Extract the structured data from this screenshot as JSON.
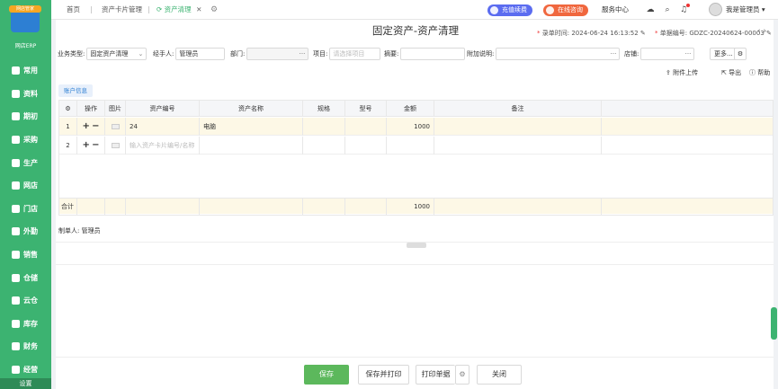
{
  "brand": {
    "badge": "网店管家",
    "logo_text": "网店ERP"
  },
  "nav": [
    {
      "label": "常用"
    },
    {
      "label": "资料"
    },
    {
      "label": "期初"
    },
    {
      "label": "采购"
    },
    {
      "label": "生产"
    },
    {
      "label": "网店"
    },
    {
      "label": "门店"
    },
    {
      "label": "外勤"
    },
    {
      "label": "销售"
    },
    {
      "label": "仓储"
    },
    {
      "label": "云仓"
    },
    {
      "label": "库存"
    },
    {
      "label": "财务"
    },
    {
      "label": "经营"
    }
  ],
  "settings_label": "设置",
  "tabs": {
    "home": "首页",
    "card_mgmt": "资产卡片管理",
    "clearance": "资产清理",
    "close": "✕"
  },
  "top_actions": {
    "recharge": "充值续费",
    "consult": "在线咨询",
    "service": "服务中心",
    "user": "我是管理员"
  },
  "colors": {
    "recharge": "#5b6cf0",
    "consult": "#f0673e",
    "accent": "#3cb371"
  },
  "page": {
    "title": "固定资产-资产清理",
    "entry_time_label": "录单时间:",
    "entry_time": "2024-06-24 16:13:52",
    "doc_no_label": "单据编号:",
    "doc_no": "GDZC-20240624-00003"
  },
  "form": {
    "biz_type_label": "业务类型:",
    "biz_type": "固定资产清理",
    "handler_label": "经手人:",
    "handler": "管理员",
    "dept_label": "部门:",
    "project_label": "项目:",
    "project_ph": "请选择项目",
    "summary_label": "摘要:",
    "note_label": "附加说明:",
    "store_label": "店铺:",
    "more_label": "更多..."
  },
  "actions": {
    "upload": "附件上传",
    "export": "导出",
    "help": "帮助"
  },
  "account_tab": "账户信息",
  "grid": {
    "headers": {
      "op": "操作",
      "img": "图片",
      "code": "资产编号",
      "name": "资产名称",
      "spec": "规格",
      "model": "型号",
      "amount": "金额",
      "remark": "备注"
    },
    "rows": [
      {
        "idx": "1",
        "code": "24",
        "name": "电脑",
        "amount": "1000"
      },
      {
        "idx": "2",
        "code_ph": "输入资产卡片编号/名称"
      }
    ],
    "total_label": "合计",
    "total_amount": "1000"
  },
  "maker": "制单人: 管理员",
  "buttons": {
    "save": "保存",
    "save_print": "保存并打印",
    "print": "打印单据",
    "close": "关闭"
  }
}
